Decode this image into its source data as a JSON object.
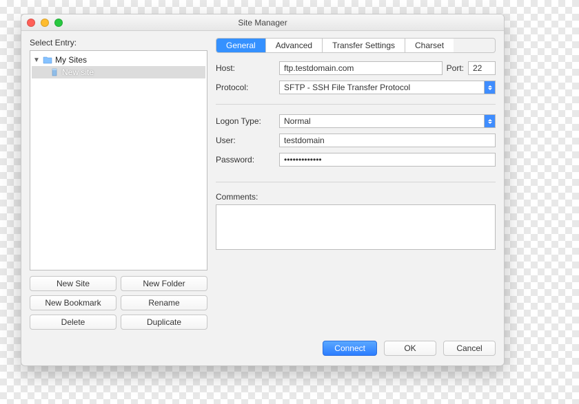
{
  "window": {
    "title": "Site Manager"
  },
  "left": {
    "label": "Select Entry:",
    "tree": {
      "root": "My Sites",
      "child": "New site"
    },
    "buttons": {
      "newSite": "New Site",
      "newFolder": "New Folder",
      "newBookmark": "New Bookmark",
      "rename": "Rename",
      "delete": "Delete",
      "duplicate": "Duplicate"
    }
  },
  "tabs": {
    "general": "General",
    "advanced": "Advanced",
    "transfer": "Transfer Settings",
    "charset": "Charset"
  },
  "form": {
    "hostLabel": "Host:",
    "host": "ftp.testdomain.com",
    "portLabel": "Port:",
    "port": "22",
    "protocolLabel": "Protocol:",
    "protocol": "SFTP - SSH File Transfer Protocol",
    "logonLabel": "Logon Type:",
    "logon": "Normal",
    "userLabel": "User:",
    "user": "testdomain",
    "passwordLabel": "Password:",
    "password": "•••••••••••••",
    "commentsLabel": "Comments:",
    "comments": ""
  },
  "footer": {
    "connect": "Connect",
    "ok": "OK",
    "cancel": "Cancel"
  }
}
